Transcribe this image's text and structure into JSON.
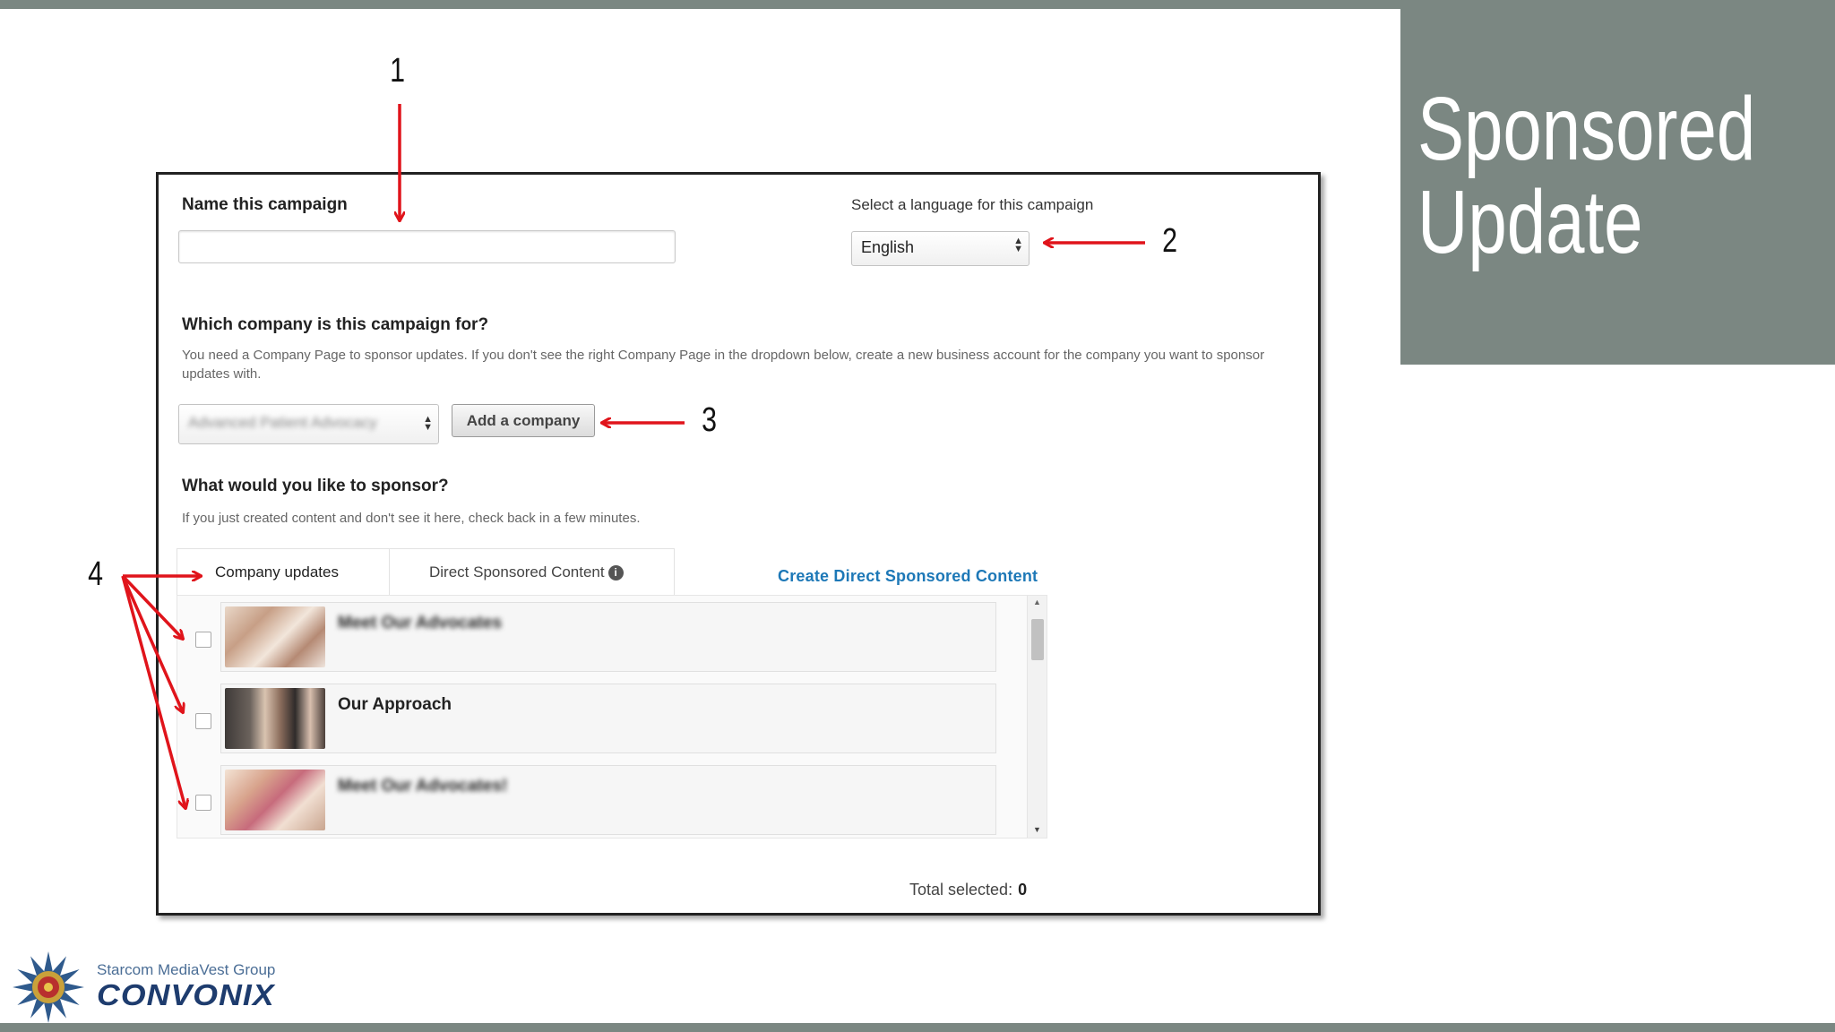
{
  "slide": {
    "title_line1": "Sponsored",
    "title_line2": "Update",
    "accent_color": "#7b8782",
    "arrow_color": "#e0141b"
  },
  "form": {
    "name_label": "Name this campaign",
    "name_value": "",
    "language_label": "Select a language for this campaign",
    "language_value": "English",
    "company_question": "Which company is this campaign for?",
    "company_help": "You need a Company Page to sponsor updates. If you don't see the right Company Page in the dropdown below, create a new business account for the company you want to sponsor updates with.",
    "company_value": "Advanced Patient Advocacy",
    "add_company_label": "Add a company",
    "sponsor_question": "What would you like to sponsor?",
    "sponsor_help": "If you just created content and don't see it here, check back in a few minutes.",
    "tabs": [
      {
        "label": "Company updates"
      },
      {
        "label": "Direct Sponsored Content"
      }
    ],
    "create_link": "Create Direct Sponsored Content",
    "updates": [
      {
        "title": "Meet Our Advocates",
        "blurred": true
      },
      {
        "title": "Our Approach",
        "blurred": false
      },
      {
        "title": "Meet Our Advocates!",
        "blurred": true
      }
    ],
    "total_label": "Total selected:",
    "total_value": "0"
  },
  "annotations": {
    "n1": "1",
    "n2": "2",
    "n3": "3",
    "n4": "4"
  },
  "logo": {
    "subtitle": "Starcom MediaVest Group",
    "name": "CONVONIX"
  },
  "icons": {
    "info": "info-icon",
    "select_arrows": "select-arrows-icon",
    "scroll_up": "scroll-up-icon",
    "scroll_down": "scroll-down-icon"
  }
}
